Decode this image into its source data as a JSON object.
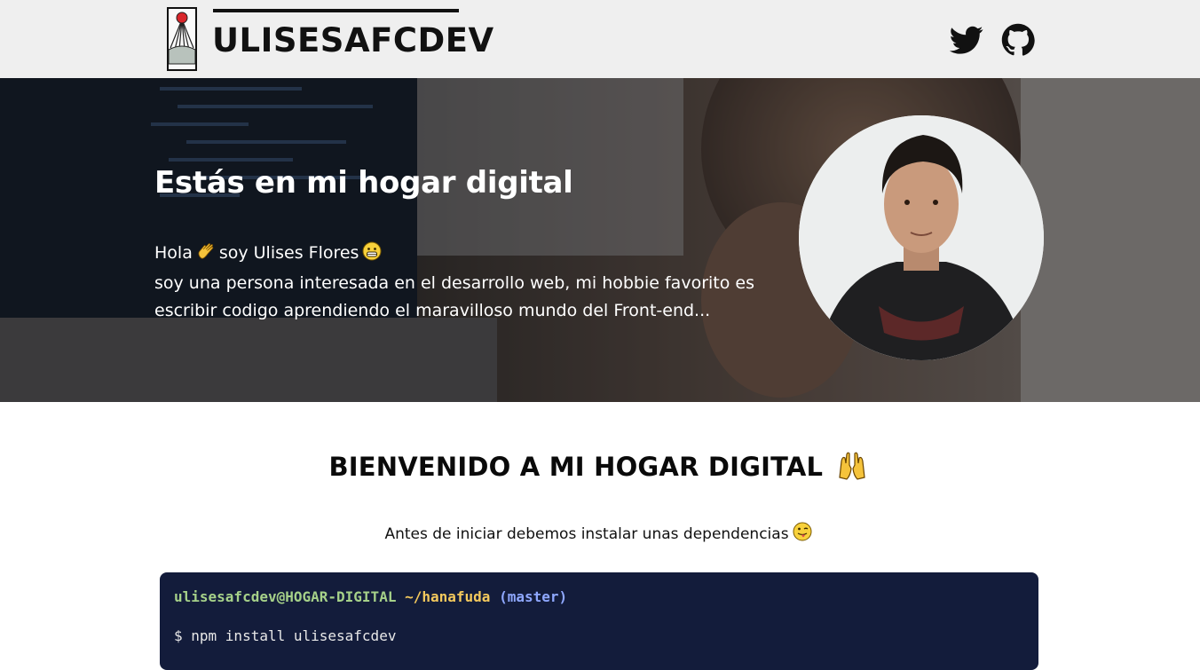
{
  "header": {
    "brand": "ULISESAFCDEV",
    "social": [
      {
        "name": "twitter",
        "icon": "twitter-icon"
      },
      {
        "name": "github",
        "icon": "github-icon"
      }
    ]
  },
  "hero": {
    "title": "Estás en mi hogar digital",
    "greeting_start": "Hola",
    "greeting_emoji": "waving-hand-emoji",
    "greeting_middle": "soy Ulises Flores",
    "greeting_end_emoji": "grinning-face-emoji",
    "line2": "soy una persona interesada en el desarrollo web, mi hobbie favorito es",
    "line3": "escribir codigo aprendiendo el maravilloso mundo del Front-end..."
  },
  "welcome": {
    "title": "BIENVENIDO A MI HOGAR DIGITAL",
    "title_emoji": "raising-hands-emoji",
    "subtitle": "Antes de iniciar debemos instalar unas dependencias",
    "subtitle_emoji": "winking-tongue-emoji"
  },
  "terminal": {
    "user_host": "ulisesafcdev@HOGAR-DIGITAL",
    "path": "~/hanafuda",
    "branch": "(master)",
    "command": "$ npm install ulisesafcdev"
  },
  "colors": {
    "header_bg": "#efefef",
    "terminal_bg": "#131c3b",
    "term_user": "#a6d189",
    "term_path": "#f4c95d",
    "term_branch": "#8fa8ff"
  }
}
